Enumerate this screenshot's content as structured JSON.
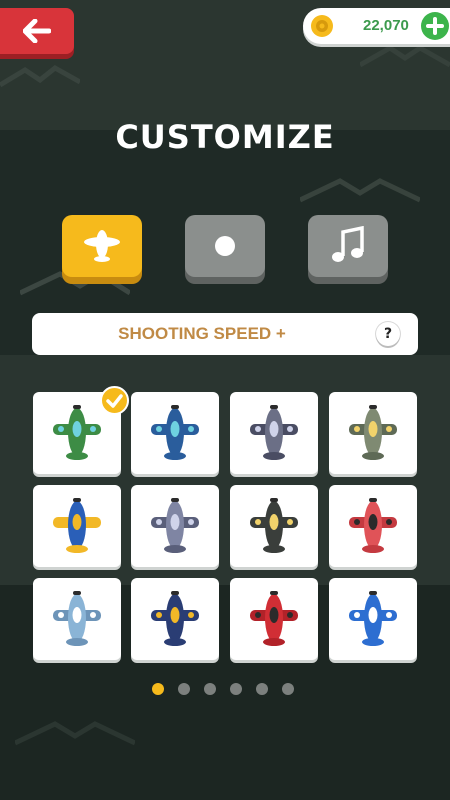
{
  "header": {
    "title": "CUSTOMIZE",
    "coins": "22,070"
  },
  "icons": {
    "back": "arrow-left-icon",
    "coin": "gear-coin-icon",
    "add": "plus-icon",
    "help": "?"
  },
  "tabs": [
    {
      "name": "plane",
      "icon": "plane-icon",
      "active": true
    },
    {
      "name": "bullet",
      "icon": "dot-icon",
      "active": false
    },
    {
      "name": "music",
      "icon": "music-note-icon",
      "active": false
    }
  ],
  "upgrade": {
    "label": "SHOOTING SPEED +"
  },
  "planes": [
    {
      "id": 1,
      "body": "#3d8c45",
      "wing": "#3d8c45",
      "accent": "#6fd2e0",
      "selected": true
    },
    {
      "id": 2,
      "body": "#2a5d9c",
      "wing": "#2a5d9c",
      "accent": "#6fd2e0",
      "selected": false
    },
    {
      "id": 3,
      "body": "#6b6f86",
      "wing": "#4a4d63",
      "accent": "#cfd3ea",
      "selected": false
    },
    {
      "id": 4,
      "body": "#7f8a72",
      "wing": "#5e6a56",
      "accent": "#f2d36b",
      "selected": false
    },
    {
      "id": 5,
      "body": "#2a5fb8",
      "wing": "#f2b827",
      "accent": "#f2b827",
      "selected": false
    },
    {
      "id": 6,
      "body": "#7f85a3",
      "wing": "#5a5f7a",
      "accent": "#cfd3ea",
      "selected": false
    },
    {
      "id": 7,
      "body": "#3a3e3b",
      "wing": "#3a3e3b",
      "accent": "#f2d36b",
      "selected": false
    },
    {
      "id": 8,
      "body": "#e05358",
      "wing": "#c43a40",
      "accent": "#2b2b2b",
      "selected": false
    },
    {
      "id": 9,
      "body": "#8ab4d6",
      "wing": "#6d94b8",
      "accent": "#ffffff",
      "selected": false
    },
    {
      "id": 10,
      "body": "#2a3d74",
      "wing": "#2a3d74",
      "accent": "#f2b827",
      "selected": false
    },
    {
      "id": 11,
      "body": "#d12e35",
      "wing": "#b22229",
      "accent": "#2b2b2b",
      "selected": false
    },
    {
      "id": 12,
      "body": "#2d6ed1",
      "wing": "#2d6ed1",
      "accent": "#ffffff",
      "selected": false
    }
  ],
  "pagination": {
    "pages": 6,
    "current": 1
  },
  "colors": {
    "background": "#1f2a26",
    "accent": "#f6ba1c",
    "back_button": "#d8343a",
    "coin_text": "#3c9a4d",
    "upgrade_text": "#c08a45"
  }
}
